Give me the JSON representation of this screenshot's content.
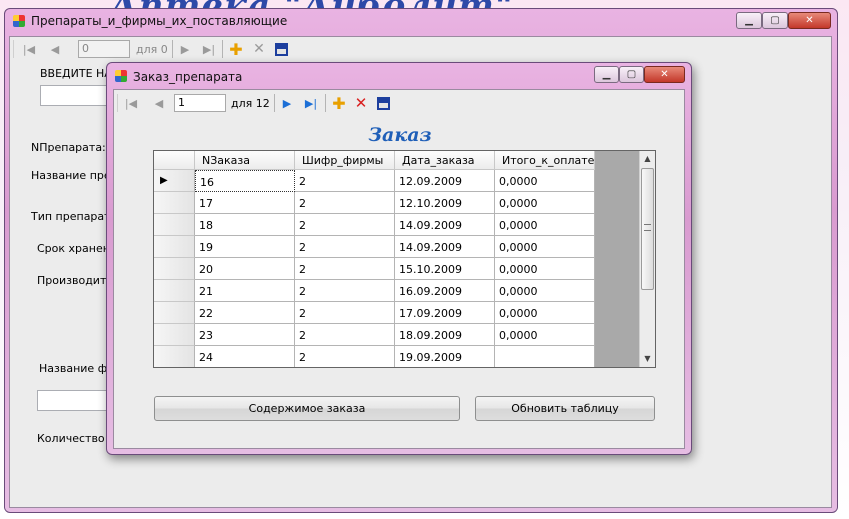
{
  "background": {
    "banner": "Аптека \"Айболит\""
  },
  "main_window": {
    "title": "Препараты_и_фирмы_их_поставляющие",
    "nav": {
      "position": "0",
      "count": "для 0"
    },
    "labels": {
      "enter": "ВВЕДИТЕ НА",
      "n_prep": "NПрепарата:",
      "name_prep": "Название преп",
      "type_prep": "Тип препарата:",
      "shelf": "Срок хранения",
      "maker": "Производител",
      "firm_name": "Название фи",
      "qty": "Количество шт"
    }
  },
  "child_window": {
    "title": "Заказ_препарата",
    "nav": {
      "position": "1",
      "count": "для 12"
    },
    "heading": "Заказ",
    "grid": {
      "columns": [
        "NЗаказа",
        "Шифр_фирмы",
        "Дата_заказа",
        "Итого_к_оплате_з"
      ],
      "current_row_marker": "▶",
      "rows": [
        [
          "16",
          "2",
          "12.09.2009",
          "0,0000"
        ],
        [
          "17",
          "2",
          "12.10.2009",
          "0,0000"
        ],
        [
          "18",
          "2",
          "14.09.2009",
          "0,0000"
        ],
        [
          "19",
          "2",
          "14.09.2009",
          "0,0000"
        ],
        [
          "20",
          "2",
          "15.10.2009",
          "0,0000"
        ],
        [
          "21",
          "2",
          "16.09.2009",
          "0,0000"
        ],
        [
          "22",
          "2",
          "17.09.2009",
          "0,0000"
        ],
        [
          "23",
          "2",
          "18.09.2009",
          "0,0000"
        ],
        [
          "24",
          "2",
          "19.09.2009",
          ""
        ]
      ]
    },
    "buttons": {
      "contents": "Содержимое заказа",
      "refresh": "Обновить таблицу"
    }
  },
  "colors": {
    "heading": "#1f5fb8",
    "nav_arrows": "#1c6fd6",
    "add_icon": "#e8a000",
    "delete_icon": "#d92020",
    "save_icon": "#1d3f9e"
  },
  "icons": [
    "move-first-icon",
    "move-previous-icon",
    "move-next-icon",
    "move-last-icon",
    "add-icon",
    "delete-icon",
    "save-icon",
    "minimize-icon",
    "maximize-icon",
    "close-icon",
    "app-icon"
  ]
}
